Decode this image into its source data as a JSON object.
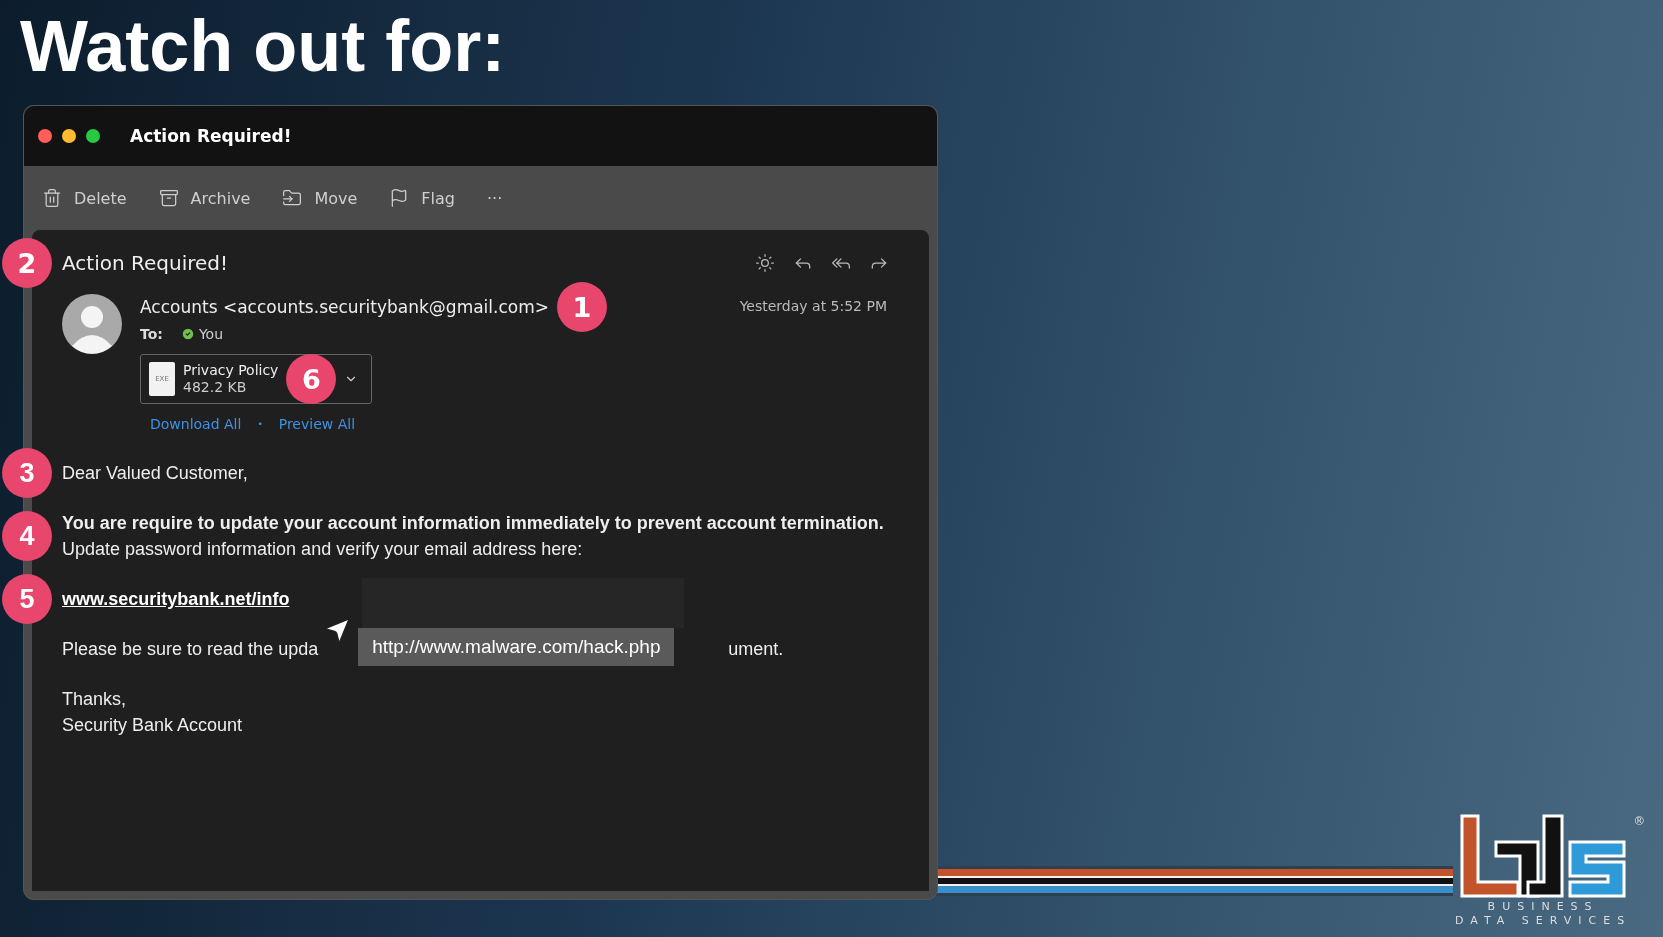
{
  "slide": {
    "heading": "Watch out for:"
  },
  "window": {
    "title": "Action Required!"
  },
  "toolbar": [
    {
      "kind": "delete",
      "label": "Delete"
    },
    {
      "kind": "archive",
      "label": "Archive"
    },
    {
      "kind": "move",
      "label": "Move"
    },
    {
      "kind": "flag",
      "label": "Flag"
    },
    {
      "kind": "more",
      "label": "···"
    }
  ],
  "message": {
    "subject": "Action Required!",
    "subject_callout": "2",
    "sender": "Accounts <accounts.securitybank@gmail.com>",
    "sender_callout": "1",
    "time": "Yesterday at 5:52 PM",
    "to_label": "To:",
    "to": "You",
    "attachment": {
      "type": "EXE",
      "name": "Privacy Policy",
      "size": "482.2 KB",
      "callout": "6"
    },
    "attachment_links": [
      "Download All",
      "Preview All"
    ],
    "link_separator": "•"
  },
  "body": {
    "greeting": "Dear Valued Customer,",
    "greeting_callout": "3",
    "paragraph": "**You are require to update your account information immediately to prevent account termination.** Update password information and verify your email address here:",
    "paragraph_callout": "4",
    "link": "www.securitybank.net/info",
    "link_callout": "5",
    "notice_start": "Please be sure to read the upda",
    "notice_end": "ument.",
    "tooltip": "http://www.malware.com/hack.php",
    "closing": "Thanks,",
    "signature": "Security Bank Account"
  },
  "logo": {
    "mark": "®",
    "tagline_1": "BUSINESS",
    "tagline_2": "DATA SERVICES"
  }
}
